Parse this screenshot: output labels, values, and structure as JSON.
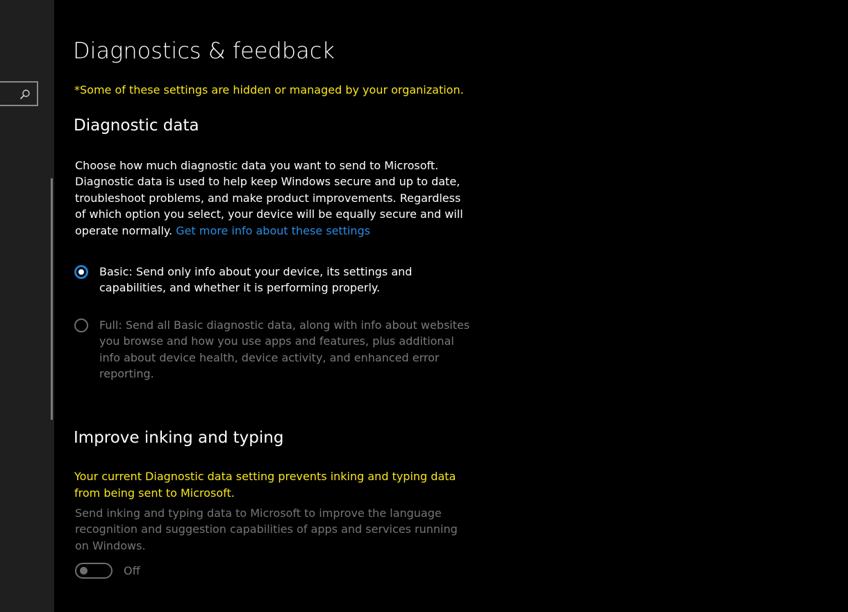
{
  "sidebar": {
    "search_icon": "search-icon"
  },
  "header": {
    "title": "Diagnostics & feedback"
  },
  "managed_notice": "*Some of these settings are hidden or managed by your organization.",
  "diagnostic_data": {
    "title": "Diagnostic data",
    "description": "Choose how much diagnostic data you want to send to Microsoft. Diagnostic data is used to help keep Windows secure and up to date, troubleshoot problems, and make product improvements. Regardless of which option you select, your device will be equally secure and will operate normally.",
    "link_text": "Get more info about these settings",
    "options": [
      {
        "label": "Basic: Send only info about your device, its settings and capabilities, and whether it is performing properly.",
        "selected": true,
        "enabled": true
      },
      {
        "label": "Full: Send all Basic diagnostic data, along with info about websites you browse and how you use apps and features, plus additional info about device health, device activity, and enhanced error reporting.",
        "selected": false,
        "enabled": false
      }
    ]
  },
  "inking_typing": {
    "title": "Improve inking and typing",
    "warning": "Your current Diagnostic data setting prevents inking and typing data from being sent to Microsoft.",
    "description": "Send inking and typing data to Microsoft to improve the language recognition and suggestion capabilities of apps and services running on Windows.",
    "toggle_state": "Off",
    "toggle_on": false
  },
  "colors": {
    "accent": "#1a7fd4",
    "link": "#2a8de4",
    "warning": "#f8e71c",
    "disabled": "#767676"
  }
}
